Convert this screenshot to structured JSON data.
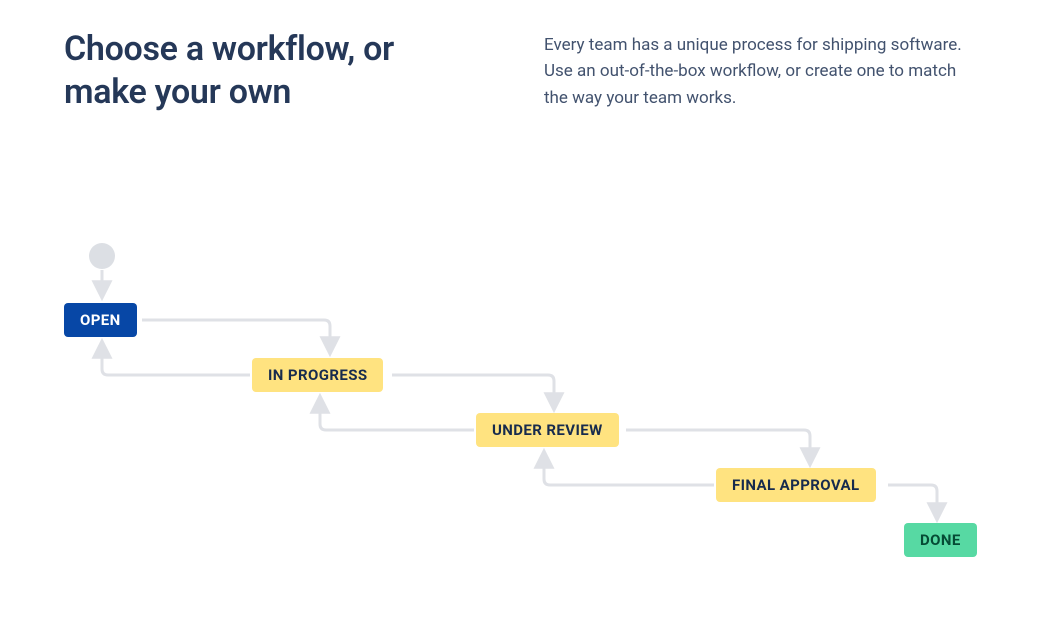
{
  "header": {
    "heading": "Choose a workflow, or make your own",
    "description": "Every team has a unique process for shipping software. Use an out-of-the-box workflow, or create one to match the way your team works."
  },
  "workflow": {
    "nodes": {
      "open": "OPEN",
      "in_progress": "IN PROGRESS",
      "under_review": "UNDER REVIEW",
      "final_approval": "FINAL APPROVAL",
      "done": "DONE"
    },
    "colors": {
      "open_bg": "#0747a6",
      "progress_bg": "#ffe380",
      "done_bg": "#57d9a3",
      "connector": "#dfe1e6"
    }
  }
}
